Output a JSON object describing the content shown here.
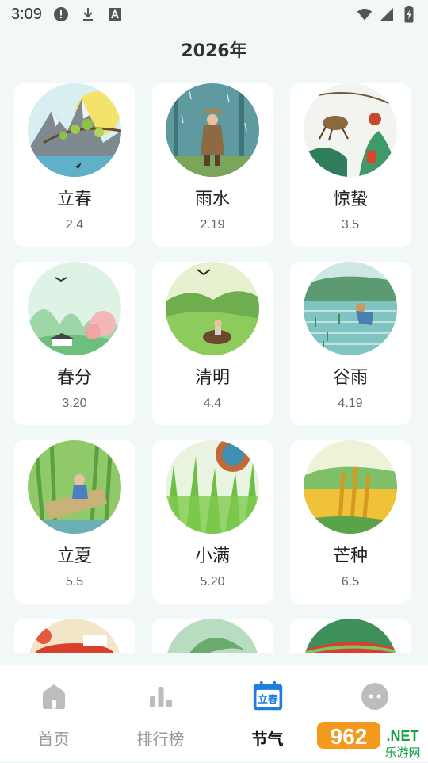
{
  "status_bar": {
    "time": "3:09"
  },
  "header": {
    "year_title": "2026年"
  },
  "terms": [
    {
      "name": "立春",
      "date": "2.4"
    },
    {
      "name": "雨水",
      "date": "2.19"
    },
    {
      "name": "惊蛰",
      "date": "3.5"
    },
    {
      "name": "春分",
      "date": "3.20"
    },
    {
      "name": "清明",
      "date": "4.4"
    },
    {
      "name": "谷雨",
      "date": "4.19"
    },
    {
      "name": "立夏",
      "date": "5.5"
    },
    {
      "name": "小满",
      "date": "5.20"
    },
    {
      "name": "芒种",
      "date": "6.5"
    },
    {
      "name": "",
      "date": ""
    },
    {
      "name": "",
      "date": ""
    },
    {
      "name": "",
      "date": ""
    }
  ],
  "nav": {
    "items": [
      {
        "label": "首页",
        "icon": "home-icon"
      },
      {
        "label": "排行榜",
        "icon": "bar-chart-icon"
      },
      {
        "label": "节气",
        "icon": "calendar-icon",
        "badge": "立春"
      },
      {
        "label": "",
        "icon": "chat-icon"
      }
    ],
    "active": 2
  },
  "watermark": {
    "brand": "962",
    "domain": ".NET",
    "sub": "乐游网"
  },
  "colors": {
    "accent": "#1f7ee0",
    "background": "#f1f8f7"
  }
}
